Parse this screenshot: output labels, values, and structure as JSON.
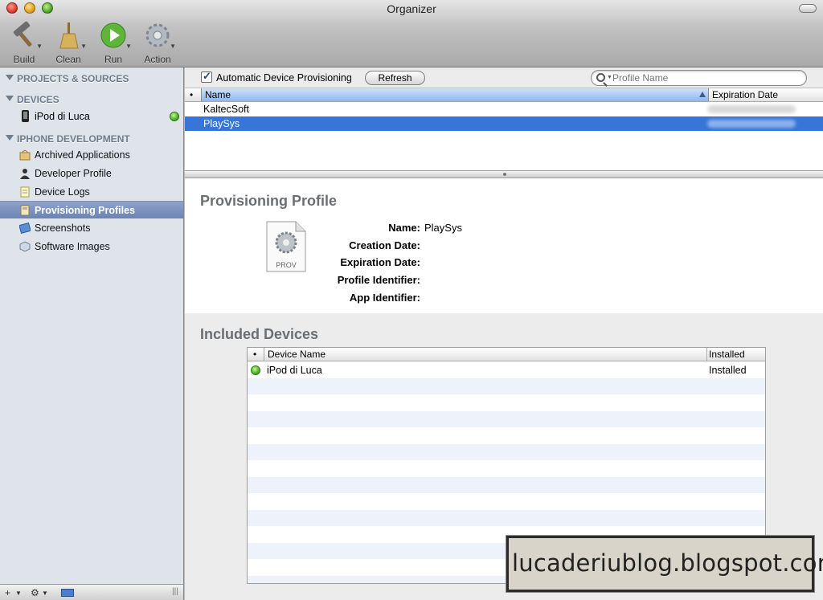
{
  "window": {
    "title": "Organizer"
  },
  "toolbar": {
    "items": [
      {
        "label": "Build",
        "icon": "hammer-icon"
      },
      {
        "label": "Clean",
        "icon": "broom-icon"
      },
      {
        "label": "Run",
        "icon": "run-icon"
      },
      {
        "label": "Action",
        "icon": "gear-icon"
      }
    ]
  },
  "sidebar": {
    "projects_header": "PROJECTS & SOURCES",
    "devices_header": "DEVICES",
    "devices": [
      {
        "label": "iPod di Luca",
        "status": "connected"
      }
    ],
    "iphone_header": "IPHONE DEVELOPMENT",
    "items": [
      {
        "label": "Archived Applications",
        "icon": "archive-icon"
      },
      {
        "label": "Developer Profile",
        "icon": "person-icon"
      },
      {
        "label": "Device Logs",
        "icon": "log-icon"
      },
      {
        "label": "Provisioning Profiles",
        "icon": "profile-icon",
        "selected": true
      },
      {
        "label": "Screenshots",
        "icon": "screenshot-icon"
      },
      {
        "label": "Software Images",
        "icon": "software-image-icon"
      }
    ],
    "bottom": {
      "add": "+",
      "action": "⚙"
    }
  },
  "profiles_toolbar": {
    "auto_provisioning_label": "Automatic Device Provisioning",
    "auto_provisioning_checked": true,
    "refresh_label": "Refresh",
    "search_placeholder": "Profile Name"
  },
  "profiles_table": {
    "columns": {
      "marker": "•",
      "name": "Name",
      "expiration": "Expiration Date"
    },
    "rows": [
      {
        "name": "KaltecSoft",
        "selected": false
      },
      {
        "name": "PlaySys",
        "selected": true
      }
    ]
  },
  "detail": {
    "heading": "Provisioning Profile",
    "file_label": "PROV",
    "fields": [
      {
        "label": "Name:",
        "value": "PlaySys"
      },
      {
        "label": "Creation Date:",
        "value": ""
      },
      {
        "label": "Expiration Date:",
        "value": ""
      },
      {
        "label": "Profile Identifier:",
        "value": ""
      },
      {
        "label": "App Identifier:",
        "value": ""
      }
    ]
  },
  "devices_section": {
    "heading": "Included Devices",
    "columns": {
      "marker": "•",
      "name": "Device Name",
      "installed": "Installed"
    },
    "rows": [
      {
        "name": "iPod di Luca",
        "installed": "Installed"
      }
    ]
  },
  "watermark": {
    "text": "lucaderiublog.blogspot.com"
  },
  "colors": {
    "selection": "#3875d7",
    "sidebar_bg": "#dee4ea",
    "sidebar_selected": "#7189b8",
    "status_green": "#3ea31b"
  }
}
